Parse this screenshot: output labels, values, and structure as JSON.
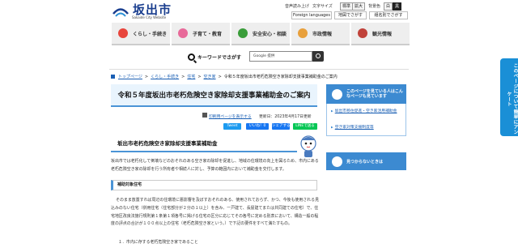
{
  "header": {
    "logo_text": "坂出市",
    "logo_sub": "Sakaide City Website",
    "links": [
      "音声読み上げ",
      "文字サイズ",
      "標準",
      "拡大",
      "背景色",
      "白",
      "黒"
    ],
    "btn_lang": "Foreign languages",
    "btn_map": "地図でさがす",
    "btn_kind": "組名別でさがす"
  },
  "nav": {
    "items": [
      {
        "label": "くらし・手続き",
        "color": "#e8453c"
      },
      {
        "label": "子育て・教育",
        "color": "#e86a9a"
      },
      {
        "label": "安全安心・相談",
        "color": "#3a9d3a"
      },
      {
        "label": "市政情報",
        "color": "#e8a03c"
      },
      {
        "label": "観光情報",
        "color": "#c0423a"
      }
    ]
  },
  "search": {
    "label": "キーワードでさがす",
    "placeholder": "Google 提供"
  },
  "breadcrumb": [
    "トップページ",
    "くらし・手続き",
    "住宅",
    "空き家",
    "令和５年度坂出市老朽危険空き家除却支援事業補助金のご案内"
  ],
  "page": {
    "title": "令和５年度坂出市老朽危険空き家除却支援事業補助金のご案内",
    "print_link": "印刷用ページを表示する",
    "updated": "更新日：2023年4月17日更新",
    "share": [
      "Tweet",
      "いいね！0",
      "シェアする",
      "LINEで送る"
    ]
  },
  "content": {
    "heading": "坂出市老朽危険空き家除却支援事業補助金",
    "para1": "坂出市では老朽化して倒壊などのおそれのある空き家の除却を促進し、地域の住環境の向上を図るため、市内にある老朽危険空き家の除却を行う所有者や相続人に対し、予算の範囲内において補助金を交付します。",
    "sub_heading": "補助対象住宅",
    "para2": "そのまま放置すれば周辺の住環境に悪影響を及ぼすおそれのある、使用されておらず、かつ、今後も使用される見込みのない住宅（併用住宅（住宅部分が２分の１以上）を含み、一戸建て、長屋建てまたは共同建ての住宅）で、住宅地区改良法施行規則第１条第１項各号に掲げる住宅の区分に応じてその各号に定める別表において、構造一般の程度の評点の合計が１００点以上の住宅（老朽危険空き家という。）で下記の要件をすべて満たすもの。",
    "list_item": "１．市内に存する老朽危険空き家であること"
  },
  "sidebar": {
    "box1_title": "このページを見ている人はこんなページも見ています",
    "links": [
      "坂出市移住促進・空き家活用補助金",
      "空き家対策支援制度等"
    ],
    "box2_title": "見つからないときは",
    "tab": "このページについて簡単にアンケート"
  }
}
